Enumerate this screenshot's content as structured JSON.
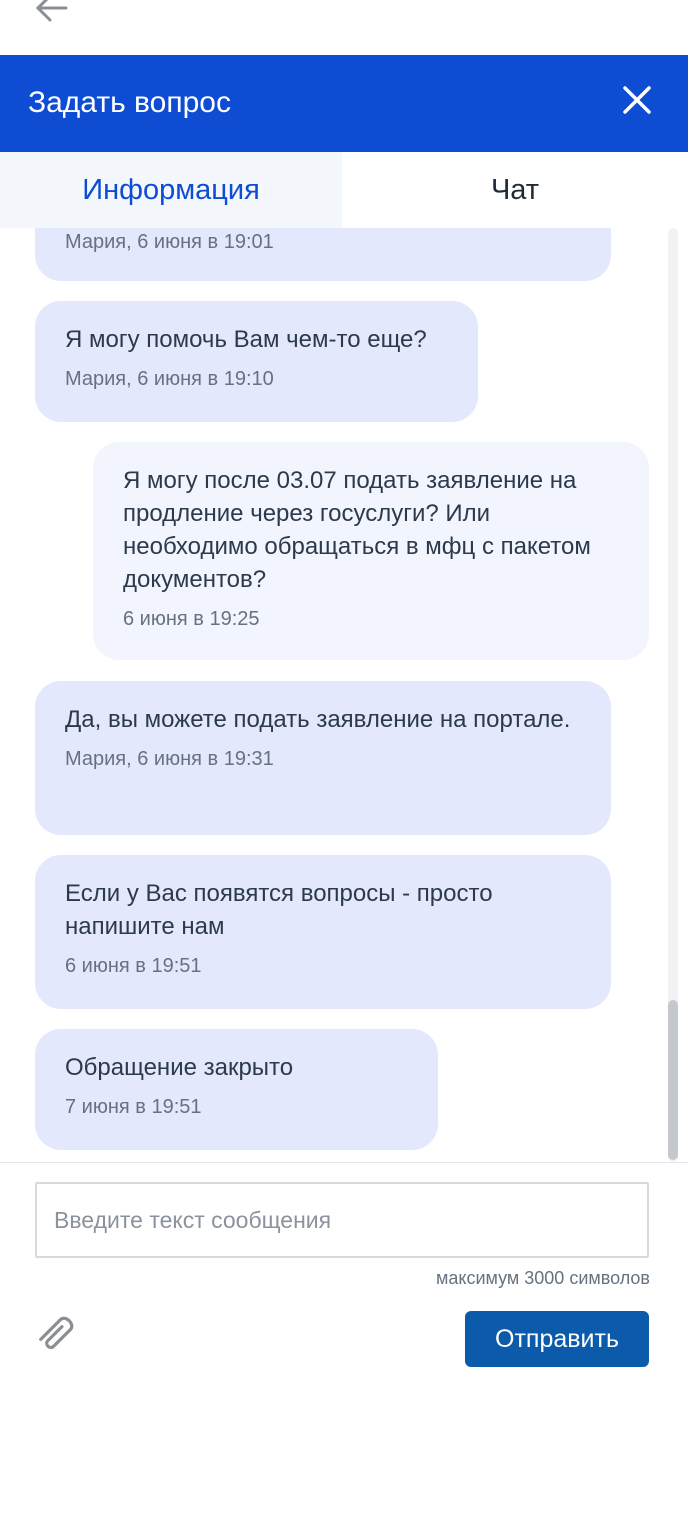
{
  "header": {
    "title": "Задать вопрос"
  },
  "tabs": [
    {
      "label": "Информация",
      "active": true
    },
    {
      "label": "Чат",
      "active": false
    }
  ],
  "messages": [
    {
      "text": "",
      "meta": "Мария, 6 июня в 19:01",
      "direction": "incoming"
    },
    {
      "text": "Я могу помочь Вам чем-то еще?",
      "meta": "Мария, 6 июня в 19:10",
      "direction": "incoming"
    },
    {
      "text": "Я могу после 03.07 подать заявление на продление через госуслуги? Или необходимо обращаться в мфц с пакетом документов?",
      "meta": "6 июня в 19:25",
      "direction": "outgoing"
    },
    {
      "text": "Да, вы можете подать заявление на портале.",
      "meta": "Мария, 6 июня в 19:31",
      "direction": "incoming"
    },
    {
      "text": "Если у Вас появятся вопросы - просто напишите нам",
      "meta": "6 июня в 19:51",
      "direction": "incoming"
    },
    {
      "text": "Обращение закрыто",
      "meta": "7 июня в 19:51",
      "direction": "incoming"
    }
  ],
  "composer": {
    "placeholder": "Введите текст сообщения",
    "value": "",
    "limit_note": "максимум 3000 символов",
    "send_label": "Отправить"
  },
  "icons": {
    "back": "arrow-left-icon",
    "close": "close-icon",
    "attach": "paperclip-icon"
  },
  "colors": {
    "brand_blue": "#0d4cd3",
    "send_button": "#0b5baa",
    "incoming_bubble": "#e4e8fd",
    "outgoing_bubble": "#f2f5fd"
  }
}
